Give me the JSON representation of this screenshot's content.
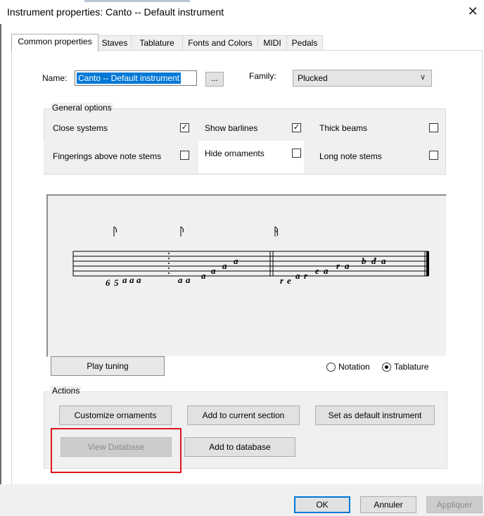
{
  "window": {
    "title": "Instrument properties: Canto -- Default instrument",
    "close_glyph": "✕"
  },
  "tabs": [
    {
      "label": "Common properties",
      "active": true
    },
    {
      "label": "Staves"
    },
    {
      "label": "Tablature"
    },
    {
      "label": "Fonts and Colors"
    },
    {
      "label": "MIDI"
    },
    {
      "label": "Pedals"
    }
  ],
  "name": {
    "label": "Name:",
    "value": "Canto -- Default instrument"
  },
  "ellipsis_label": "...",
  "family": {
    "label": "Family:",
    "value": "Plucked",
    "chevron": "∨"
  },
  "general_options": {
    "title": "General options",
    "items": [
      {
        "label": "Close systems",
        "checked": true
      },
      {
        "label": "Show barlines",
        "checked": true
      },
      {
        "label": "Thick beams",
        "checked": false
      },
      {
        "label": "Fingerings above note stems",
        "checked": false
      },
      {
        "label": "Hide ornaments",
        "checked": false
      },
      {
        "label": "Long note stems",
        "checked": false
      }
    ],
    "check_glyph": "✓"
  },
  "tablature_preview": {
    "left_numbers": [
      "6",
      "5"
    ],
    "letters": [
      "a",
      "a",
      "a",
      "a",
      "a",
      "a",
      "a",
      "a",
      "a",
      "r",
      "e",
      "a",
      "r",
      "e",
      "a",
      "r",
      "a",
      "b",
      "đ",
      "a"
    ]
  },
  "play_tuning_label": "Play tuning",
  "view_mode": {
    "options": [
      {
        "label": "Notation",
        "selected": false
      },
      {
        "label": "Tablature",
        "selected": true
      }
    ]
  },
  "actions": {
    "title": "Actions",
    "customize_ornaments": "Customize ornaments",
    "add_to_current_section": "Add to current section",
    "set_default": "Set as default instrument",
    "view_database": "View Database",
    "add_to_database": "Add to database"
  },
  "footer": {
    "ok": "OK",
    "cancel": "Annuler",
    "apply": "Appliquer"
  },
  "colors": {
    "highlight": "#e0141e",
    "selection": "#0078d7"
  }
}
